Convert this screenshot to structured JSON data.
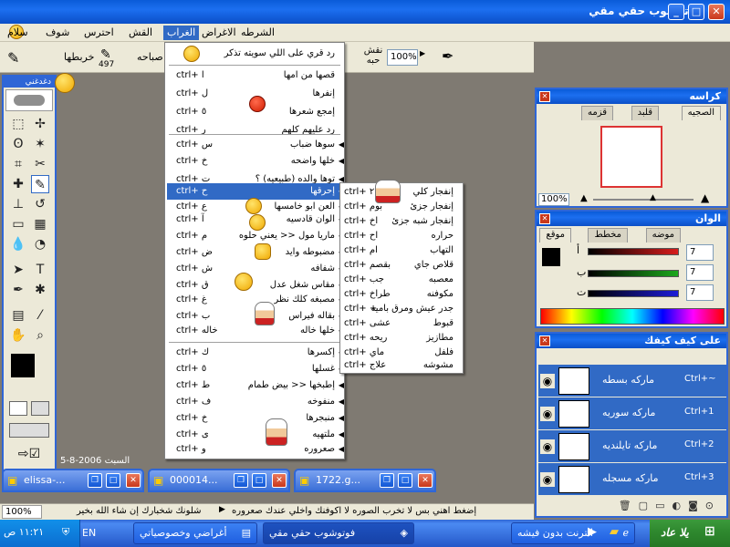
{
  "window": {
    "title": "فوتوشوب حقي مقي"
  },
  "menubar": {
    "items": [
      "الشرطه",
      "الاغراض",
      "الغراب",
      "القش",
      "احترس",
      "شوف",
      "سلام"
    ],
    "active": "الغراب"
  },
  "options": {
    "zoom_value": "100%",
    "size_label": "نقش\nحبه",
    "brush_label": "خربطها",
    "brush_num": "497",
    "mode_label": "صباحه"
  },
  "toolbox": {
    "title": "دغدغني"
  },
  "canvas": {
    "date_text": "5-8-2006 السبت"
  },
  "main_menu": {
    "items": [
      {
        "label": "رد قري على اللي سويته تذكر",
        "shortcut": ""
      },
      {
        "label": "قصها من امها",
        "shortcut": "ctrl+ l"
      },
      {
        "label": "إنفرها",
        "shortcut": "ctrl+ ل"
      },
      {
        "label": "إمجع شعرها",
        "shortcut": "ctrl+ ٥"
      },
      {
        "label": "رد عليهم كلهم",
        "shortcut": "ctrl+ ر"
      },
      {
        "label": "سوها ضباب",
        "shortcut": "ctrl+ س"
      },
      {
        "label": "خلها واضحه",
        "shortcut": "ctrl+ خ"
      },
      {
        "label": "توها والده (طبيعيه) ؟",
        "shortcut": "ctrl+ ت"
      },
      {
        "label": "إحرقها",
        "shortcut": "ctrl+ ح"
      },
      {
        "label": "العن ابو خامسها",
        "shortcut": "ctrl+ ع"
      },
      {
        "label": "الوان قادسيه",
        "shortcut": "ctrl+ آ"
      },
      {
        "label": "ماريا مول << يعني حلوه",
        "shortcut": "ctrl+ م"
      },
      {
        "label": "مضبوطه وايد",
        "shortcut": "ctrl+ ض"
      },
      {
        "label": "شفافه",
        "shortcut": "ctrl+ ش"
      },
      {
        "label": "مقاس شغل عدل",
        "shortcut": "ctrl+ ق"
      },
      {
        "label": "مصبغه كلك نظر",
        "shortcut": "ctrl+ غ"
      },
      {
        "label": "بقاله فيراس",
        "shortcut": "ctrl+ ب"
      },
      {
        "label": "خلها خاله",
        "shortcut": "ctrl+ خاله"
      },
      {
        "label": "إكسرها",
        "shortcut": "ctrl+ ك"
      },
      {
        "label": "غسلها",
        "shortcut": "ctrl+ ٥"
      },
      {
        "label": "إطبخها << بيض طمام",
        "shortcut": "ctrl+ ط"
      },
      {
        "label": "منفوخه",
        "shortcut": "ctrl+ ف"
      },
      {
        "label": "منبجرها",
        "shortcut": "ctrl+ خ"
      },
      {
        "label": "ملتهيه",
        "shortcut": "ctrl+ ى"
      },
      {
        "label": "صعروره",
        "shortcut": "ctrl+ و"
      }
    ]
  },
  "sub_menu": {
    "items": [
      {
        "label": "إنفجار كلي",
        "shortcut": "ctrl+ ٢"
      },
      {
        "label": "إنفجار جزئ",
        "shortcut": "ctrl+ بوم"
      },
      {
        "label": "إنفجار شبه جزئ",
        "shortcut": "ctrl+ اخ"
      },
      {
        "label": "حراره",
        "shortcut": "ctrl+ اح"
      },
      {
        "label": "التهاب",
        "shortcut": "ctrl+ ام"
      },
      {
        "label": "قلاص جاي",
        "shortcut": "ctrl+ بقصم"
      },
      {
        "label": "معصبه",
        "shortcut": "ctrl+ جب"
      },
      {
        "label": "مكوفنه",
        "shortcut": "ctrl+ طراخ"
      },
      {
        "label": "جدر عيش ومرق باميه",
        "shortcut": "ctrl+ +"
      },
      {
        "label": "قبوط",
        "shortcut": "ctrl+ عشى"
      },
      {
        "label": "مطازيز",
        "shortcut": "ctrl+ ريحه"
      },
      {
        "label": "فلفل",
        "shortcut": "ctrl+ ماي"
      },
      {
        "label": "مشوشه",
        "shortcut": "ctrl+ علاج"
      }
    ]
  },
  "panel_navigator": {
    "title": "كراسه",
    "tabs": [
      "الصجيه",
      "قلبد",
      "قزمه"
    ],
    "zoom": "100%"
  },
  "panel_color": {
    "title": "الوان",
    "tabs": [
      "موقع",
      "مخطط",
      "موضه"
    ],
    "channels": [
      {
        "label": "أ",
        "value": "7",
        "color": "#d81c1c"
      },
      {
        "label": "ب",
        "value": "7",
        "color": "#1ca81c"
      },
      {
        "label": "ت",
        "value": "7",
        "color": "#1c1cd8"
      }
    ]
  },
  "panel_layers": {
    "title": "على كيف كيفك",
    "layers": [
      {
        "name": "ماركه بسطه",
        "shortcut": "Ctrl+~"
      },
      {
        "name": "ماركه سوريه",
        "shortcut": "Ctrl+1"
      },
      {
        "name": "ماركه تايلنديه",
        "shortcut": "Ctrl+2"
      },
      {
        "name": "ماركه مسجله",
        "shortcut": "Ctrl+3"
      }
    ]
  },
  "minimized": [
    {
      "name": "elissa-..."
    },
    {
      "name": "000014..."
    },
    {
      "name": "1722.g..."
    }
  ],
  "status": {
    "zoom": "100%",
    "left_text": "شلونك شخبارك إن شاء الله بخير",
    "right_text": "إضغط اهني بس لا تخرب الصوره لا اكوفنك واخلي عندك صعروره"
  },
  "taskbar": {
    "start": "يلا عاد",
    "tasks": [
      "انترنت بدون فيشه",
      "فوتوشوب حقي مقي",
      "أغراضي وخصوصياتي"
    ],
    "lang": "EN",
    "clock": "١١:٢١ ص"
  }
}
